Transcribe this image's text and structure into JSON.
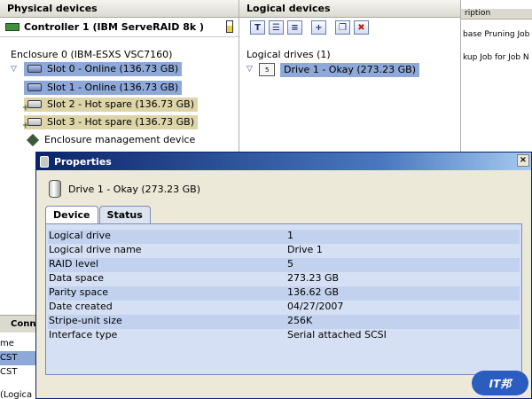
{
  "physical": {
    "title": "Physical devices",
    "controller": "Controller 1 (IBM ServeRAID 8k    )",
    "enclosure": "Enclosure 0 (IBM-ESXS VSC7160)",
    "slots": [
      {
        "label": "Slot 0 - Online (136.73 GB)"
      },
      {
        "label": "Slot 1 - Online (136.73 GB)"
      },
      {
        "label": "Slot 2 - Hot spare (136.73 GB)"
      },
      {
        "label": "Slot 3 - Hot spare (136.73 GB)"
      }
    ],
    "mgmt": "Enclosure management device"
  },
  "connections": {
    "tab": "Conn",
    "rows": [
      "me",
      "CST",
      "CST"
    ],
    "status_fragment": "(Logica"
  },
  "logical": {
    "title": "Logical devices",
    "drives_label": "Logical drives (1)",
    "drive": "Drive 1 - Okay (273.23 GB)",
    "drive_icon_text": "5"
  },
  "jobs": {
    "header": "ription",
    "items": [
      "base Pruning Job",
      "kup Job for Job N"
    ]
  },
  "dialog": {
    "title": "Properties",
    "close": "×",
    "heading": "Drive 1 - Okay (273.23 GB)",
    "tabs": [
      "Device",
      "Status"
    ],
    "props": [
      {
        "k": "Logical drive",
        "v": "1"
      },
      {
        "k": "Logical drive name",
        "v": "Drive 1"
      },
      {
        "k": "RAID level",
        "v": "5"
      },
      {
        "k": "Data space",
        "v": "273.23 GB"
      },
      {
        "k": "Parity space",
        "v": "136.62 GB"
      },
      {
        "k": "Date created",
        "v": "04/27/2007"
      },
      {
        "k": "Stripe-unit size",
        "v": "256K"
      },
      {
        "k": "Interface type",
        "v": "Serial attached SCSI"
      }
    ]
  },
  "watermark": "IT邦"
}
